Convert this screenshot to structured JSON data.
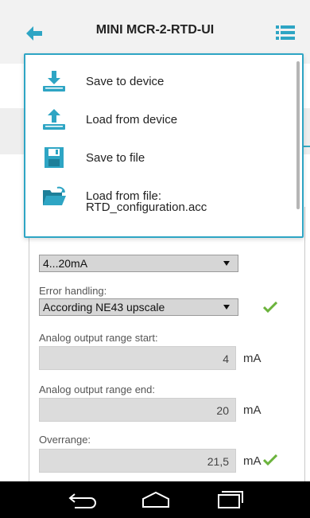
{
  "header": {
    "title": "MINI MCR-2-RTD-UI"
  },
  "popup": {
    "items": [
      {
        "label": "Save to device",
        "icon": "download-icon"
      },
      {
        "label": "Load from device",
        "icon": "upload-icon"
      },
      {
        "label": "Save to file",
        "icon": "floppy-disk-icon"
      },
      {
        "label": "Load from file:",
        "icon": "folder-open-icon"
      }
    ],
    "file_name": "RTD_configuration.acc"
  },
  "form": {
    "output_select": "4...20mA",
    "error_label": "Error handling:",
    "error_select": "According NE43 upscale",
    "range_start_label": "Analog output range start:",
    "range_start_value": "4",
    "range_start_unit": "mA",
    "range_end_label": "Analog output range end:",
    "range_end_value": "20",
    "range_end_unit": "mA",
    "overrange_label": "Overrange:",
    "overrange_value": "21,5",
    "overrange_unit": "mA"
  },
  "colors": {
    "accent": "#2ea5c4",
    "check": "#6bb33c"
  }
}
